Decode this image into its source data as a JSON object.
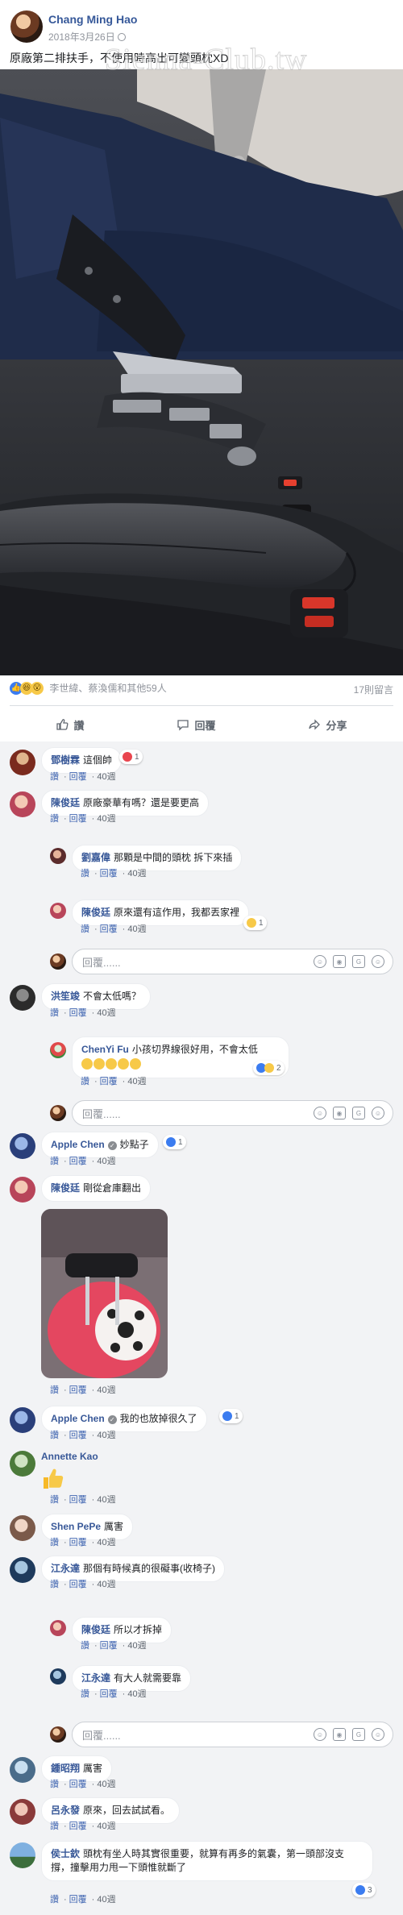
{
  "post": {
    "author": "Chang Ming Hao",
    "date": "2018年3月26日",
    "text": "原廠第二排扶手，不使用時高出可變頭枕XD",
    "watermark": "Sienna-Club.tw"
  },
  "reactions": {
    "summary": "李世緯、蔡渙儒和其他59人",
    "comment_count": "17則留言"
  },
  "actions": {
    "like": "讚",
    "comment": "回覆",
    "share": "分享"
  },
  "labels": {
    "like": "讚",
    "reply": "回覆",
    "time": "40週",
    "dot": "·",
    "reply_placeholder": "回覆......"
  },
  "comments": [
    {
      "name": "鄧樹霖",
      "text": "這個帥",
      "reactions": "1"
    },
    {
      "name": "陳俊廷",
      "text": "原廠豪華有嗎？還是要更高",
      "replies": [
        {
          "name": "劉嘉偉",
          "text": "那顆是中間的頭枕 拆下來插"
        },
        {
          "name": "陳俊廷",
          "text": "原來還有這作用，我都丟家裡",
          "reactions": "1"
        }
      ]
    },
    {
      "name": "洪笙竣",
      "text": "不會太低嗎？",
      "replies": [
        {
          "name": "ChenYi Fu",
          "text": "小孩切界線很好用，不會太低",
          "reactions": "2"
        }
      ]
    },
    {
      "name": "Apple Chen",
      "text": "妙點子",
      "reactions": "1"
    },
    {
      "name": "陳俊廷",
      "text": "剛從倉庫翻出"
    },
    {
      "name": "Apple Chen",
      "text": "我的也放掉很久了",
      "reactions": "1"
    },
    {
      "name": "Annette Kao",
      "text": ""
    },
    {
      "name": "Shen PePe",
      "text": "厲害"
    },
    {
      "name": "江永達",
      "text": "那個有時候真的很礙事(收椅子)",
      "replies": [
        {
          "name": "陳俊廷",
          "text": "所以才拆掉"
        },
        {
          "name": "江永達",
          "text": "有大人就需要靠"
        }
      ]
    },
    {
      "name": "鍾昭翔",
      "text": "厲害"
    },
    {
      "name": "呂永發",
      "text": "原來，回去試試看。"
    },
    {
      "name": "侯士欽",
      "text": "頭枕有坐人時其實很重要，就算有再多的氣囊，第一頭部沒支撐，撞擊用力甩一下頭惟就斷了",
      "reactions": "3"
    }
  ]
}
